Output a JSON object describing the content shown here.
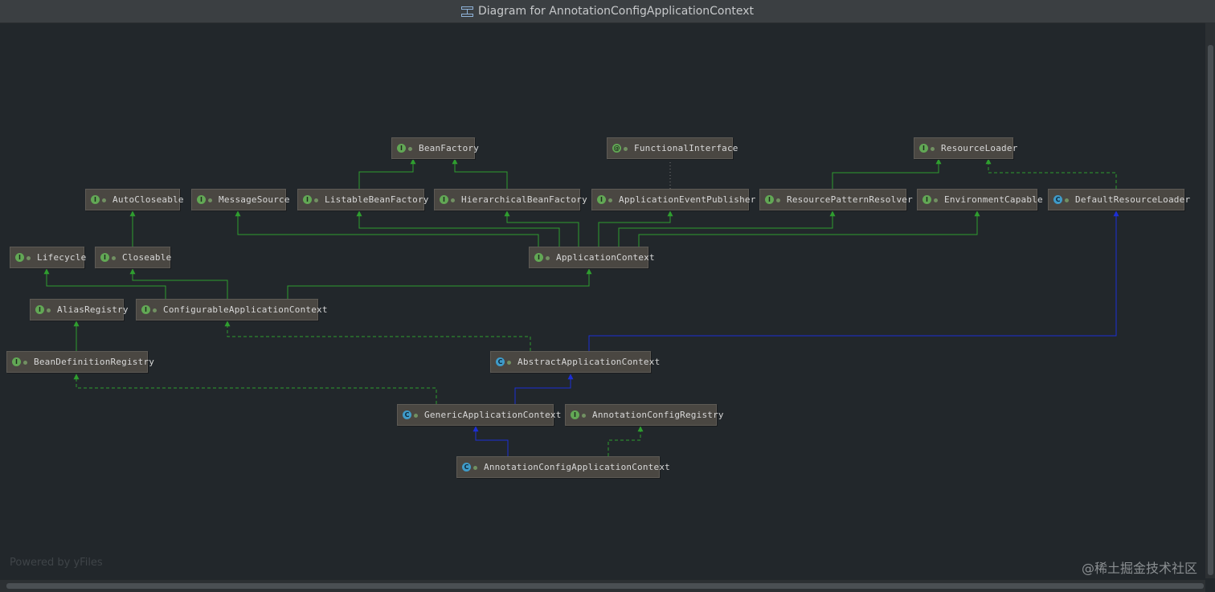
{
  "window": {
    "title": "Diagram for AnnotationConfigApplicationContext"
  },
  "footer": {
    "powered_by": "Powered by yFiles",
    "watermark": "@稀土掘金技术社区"
  },
  "colors": {
    "background": "#22272b",
    "node_fill": "#4a4742",
    "extends_interface": "#2f9e2f",
    "implements": "#2f9e2f",
    "extends_class": "#1c2fd6",
    "annotation_link": "#7a7a7a"
  },
  "nodes": [
    {
      "id": "BeanFactory",
      "label": "BeanFactory",
      "kind": "interface"
    },
    {
      "id": "FunctionalInterface",
      "label": "FunctionalInterface",
      "kind": "interface"
    },
    {
      "id": "ResourceLoader",
      "label": "ResourceLoader",
      "kind": "interface"
    },
    {
      "id": "AutoCloseable",
      "label": "AutoCloseable",
      "kind": "interface"
    },
    {
      "id": "MessageSource",
      "label": "MessageSource",
      "kind": "interface"
    },
    {
      "id": "ListableBeanFactory",
      "label": "ListableBeanFactory",
      "kind": "interface"
    },
    {
      "id": "HierarchicalBeanFactory",
      "label": "HierarchicalBeanFactory",
      "kind": "interface"
    },
    {
      "id": "ApplicationEventPublisher",
      "label": "ApplicationEventPublisher",
      "kind": "interface"
    },
    {
      "id": "ResourcePatternResolver",
      "label": "ResourcePatternResolver",
      "kind": "interface"
    },
    {
      "id": "EnvironmentCapable",
      "label": "EnvironmentCapable",
      "kind": "interface"
    },
    {
      "id": "DefaultResourceLoader",
      "label": "DefaultResourceLoader",
      "kind": "class"
    },
    {
      "id": "Lifecycle",
      "label": "Lifecycle",
      "kind": "interface"
    },
    {
      "id": "Closeable",
      "label": "Closeable",
      "kind": "interface"
    },
    {
      "id": "ApplicationContext",
      "label": "ApplicationContext",
      "kind": "interface"
    },
    {
      "id": "AliasRegistry",
      "label": "AliasRegistry",
      "kind": "interface"
    },
    {
      "id": "ConfigurableApplicationContext",
      "label": "ConfigurableApplicationContext",
      "kind": "interface"
    },
    {
      "id": "BeanDefinitionRegistry",
      "label": "BeanDefinitionRegistry",
      "kind": "interface"
    },
    {
      "id": "AbstractApplicationContext",
      "label": "AbstractApplicationContext",
      "kind": "abstract"
    },
    {
      "id": "GenericApplicationContext",
      "label": "GenericApplicationContext",
      "kind": "class"
    },
    {
      "id": "AnnotationConfigRegistry",
      "label": "AnnotationConfigRegistry",
      "kind": "interface"
    },
    {
      "id": "AnnotationConfigApplicationContext",
      "label": "AnnotationConfigApplicationContext",
      "kind": "class"
    }
  ],
  "edges": [
    {
      "from": "ListableBeanFactory",
      "to": "BeanFactory",
      "type": "extends"
    },
    {
      "from": "HierarchicalBeanFactory",
      "to": "BeanFactory",
      "type": "extends"
    },
    {
      "from": "ApplicationEventPublisher",
      "to": "FunctionalInterface",
      "type": "annotated"
    },
    {
      "from": "ResourcePatternResolver",
      "to": "ResourceLoader",
      "type": "extends"
    },
    {
      "from": "DefaultResourceLoader",
      "to": "ResourceLoader",
      "type": "implements"
    },
    {
      "from": "Closeable",
      "to": "AutoCloseable",
      "type": "extends"
    },
    {
      "from": "ApplicationContext",
      "to": "MessageSource",
      "type": "extends"
    },
    {
      "from": "ApplicationContext",
      "to": "ListableBeanFactory",
      "type": "extends"
    },
    {
      "from": "ApplicationContext",
      "to": "HierarchicalBeanFactory",
      "type": "extends"
    },
    {
      "from": "ApplicationContext",
      "to": "ApplicationEventPublisher",
      "type": "extends"
    },
    {
      "from": "ApplicationContext",
      "to": "ResourcePatternResolver",
      "type": "extends"
    },
    {
      "from": "ApplicationContext",
      "to": "EnvironmentCapable",
      "type": "extends"
    },
    {
      "from": "ConfigurableApplicationContext",
      "to": "Lifecycle",
      "type": "extends"
    },
    {
      "from": "ConfigurableApplicationContext",
      "to": "Closeable",
      "type": "extends"
    },
    {
      "from": "ConfigurableApplicationContext",
      "to": "ApplicationContext",
      "type": "extends"
    },
    {
      "from": "BeanDefinitionRegistry",
      "to": "AliasRegistry",
      "type": "extends"
    },
    {
      "from": "AbstractApplicationContext",
      "to": "ConfigurableApplicationContext",
      "type": "implements"
    },
    {
      "from": "AbstractApplicationContext",
      "to": "DefaultResourceLoader",
      "type": "extends_class"
    },
    {
      "from": "GenericApplicationContext",
      "to": "AbstractApplicationContext",
      "type": "extends_class"
    },
    {
      "from": "GenericApplicationContext",
      "to": "BeanDefinitionRegistry",
      "type": "implements"
    },
    {
      "from": "AnnotationConfigApplicationContext",
      "to": "GenericApplicationContext",
      "type": "extends_class"
    },
    {
      "from": "AnnotationConfigApplicationContext",
      "to": "AnnotationConfigRegistry",
      "type": "implements"
    }
  ]
}
